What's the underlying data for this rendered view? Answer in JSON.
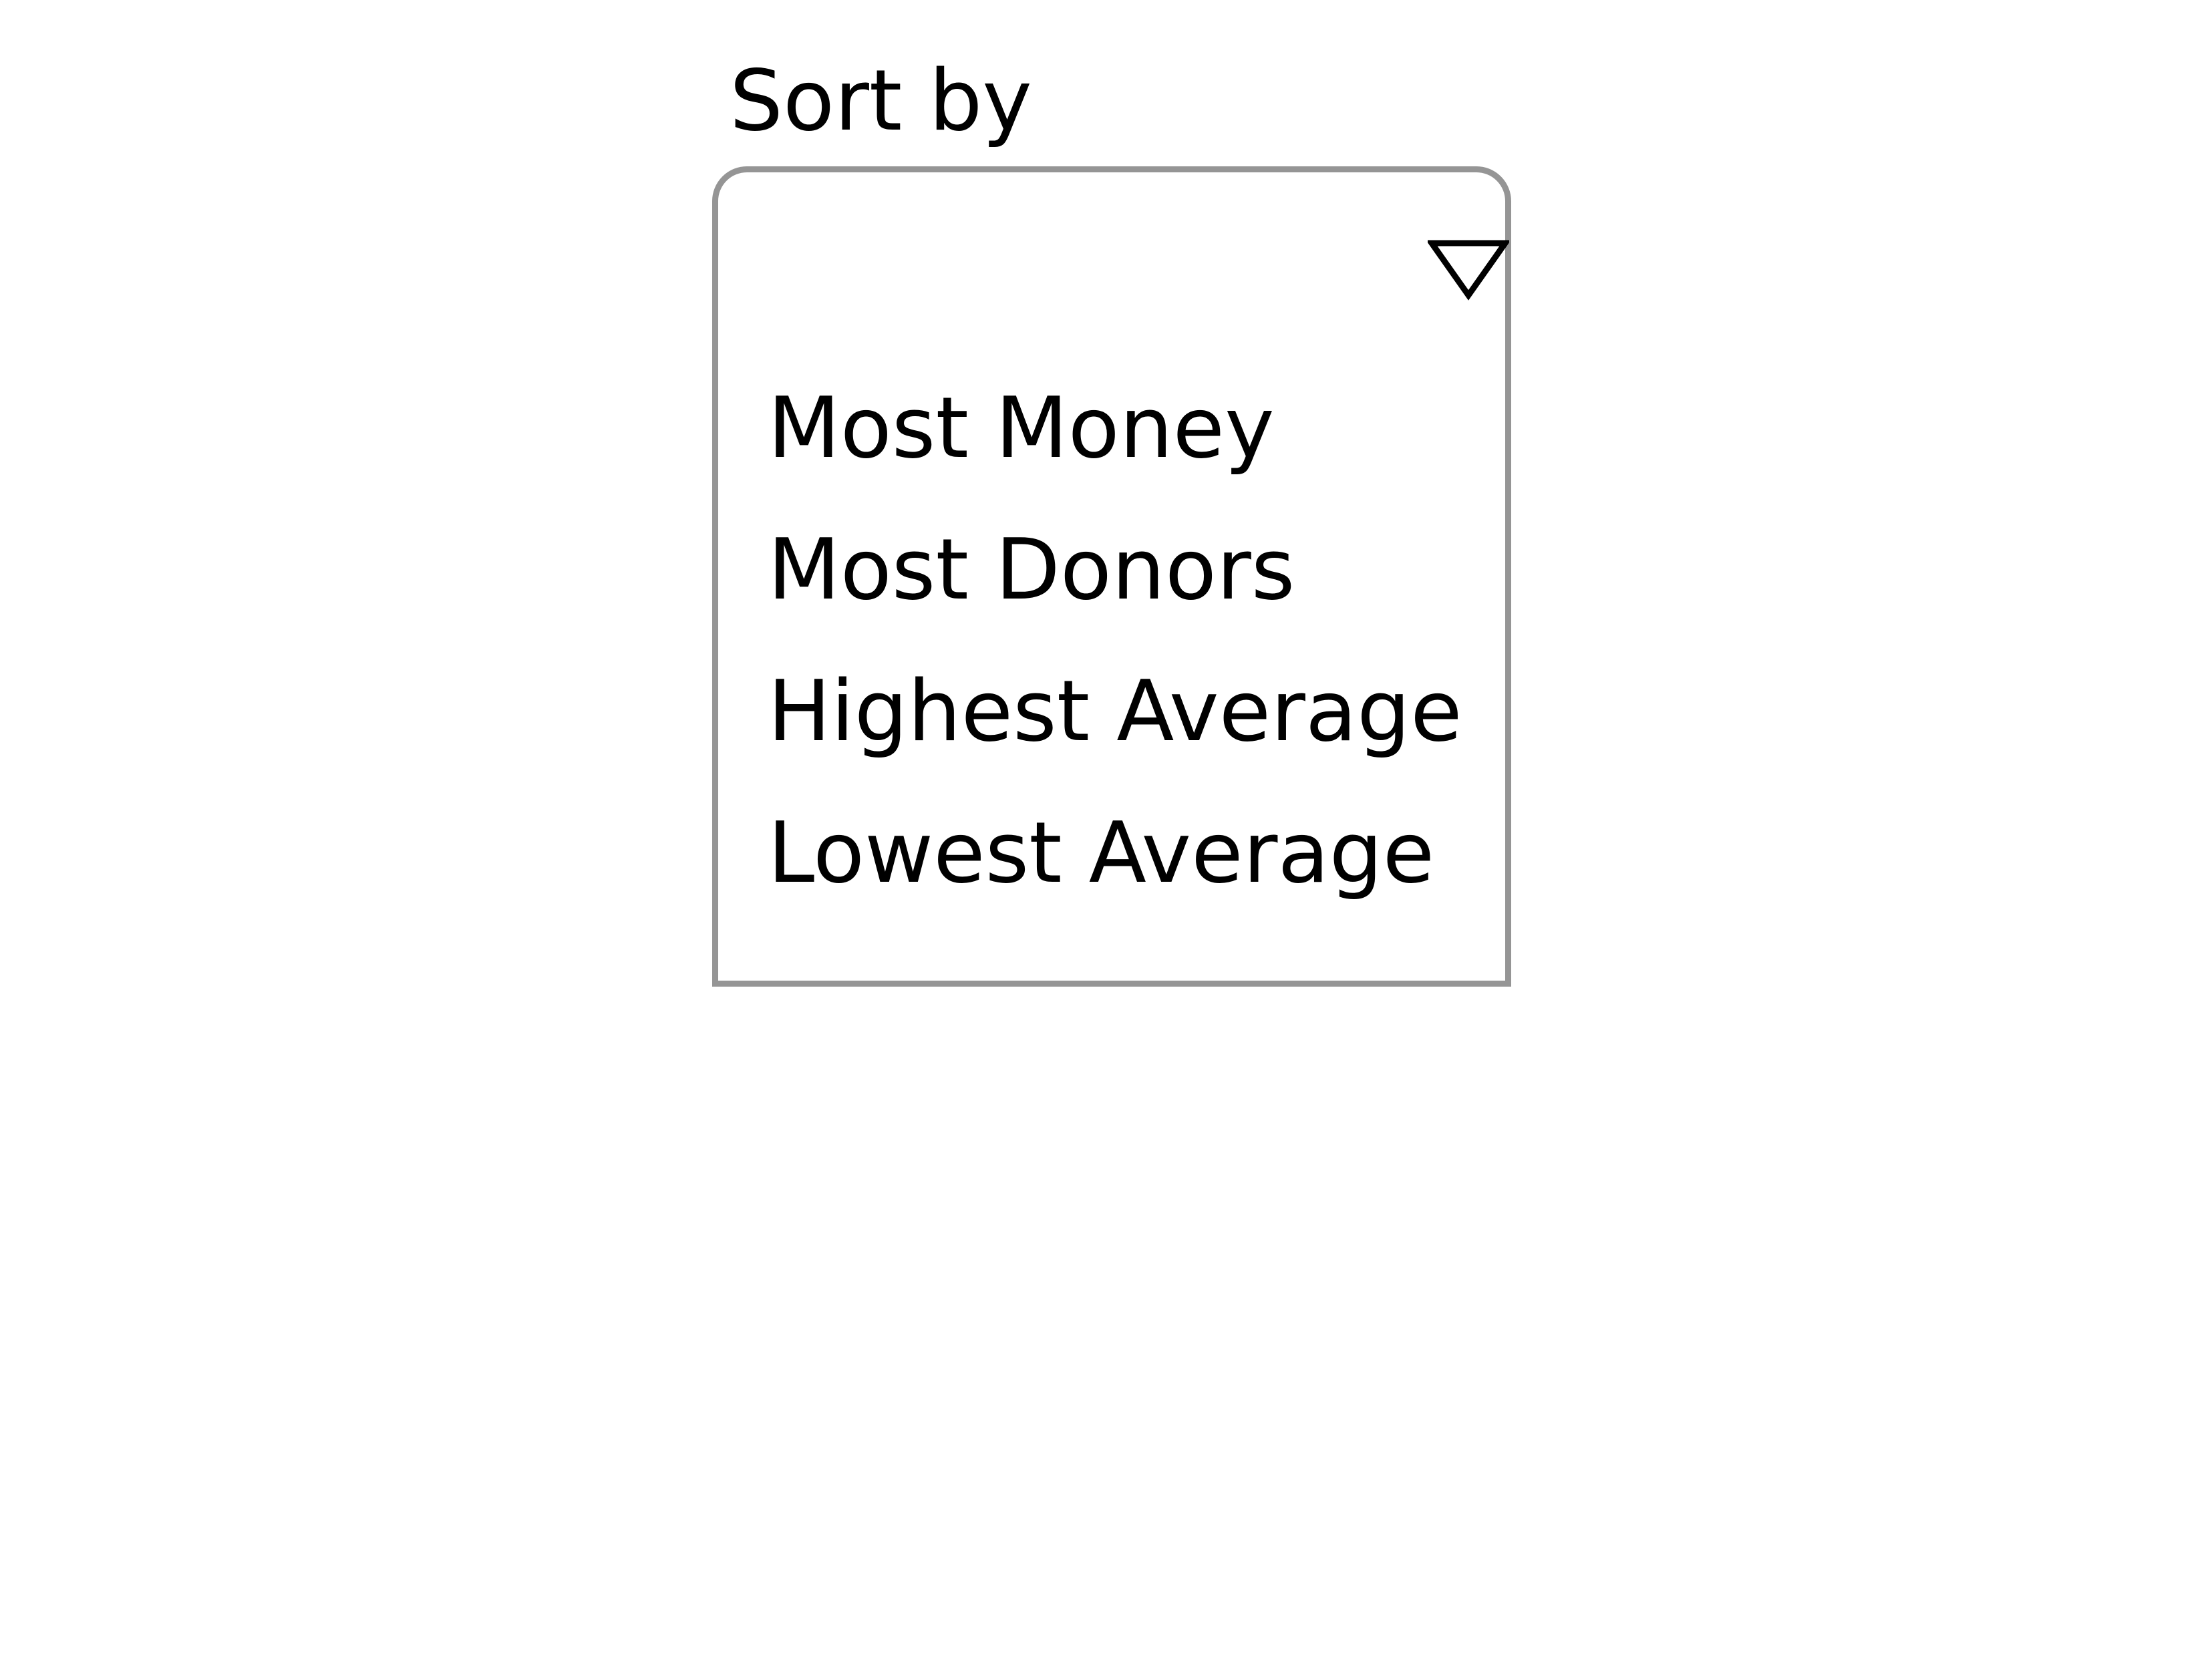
{
  "sort": {
    "label": "Sort by",
    "selected_value": "",
    "caret_icon": "triangle-down-icon",
    "options": [
      {
        "label": "Most Money"
      },
      {
        "label": "Most Donors"
      },
      {
        "label": "Highest Average"
      },
      {
        "label": "Lowest Average"
      }
    ]
  },
  "colors": {
    "border": "#959595",
    "text": "#000000",
    "background": "#ffffff"
  }
}
